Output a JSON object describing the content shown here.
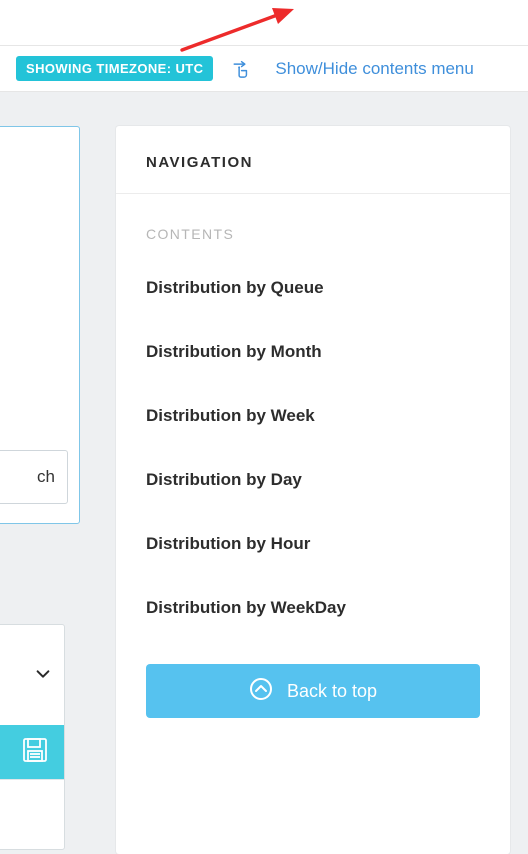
{
  "header": {
    "timezone_badge": "SHOWING TIMEZONE: UTC",
    "menu_link": "Show/Hide contents menu"
  },
  "left_fragments": {
    "search_partial": "ch"
  },
  "navigation": {
    "title": "NAVIGATION",
    "section_label": "CONTENTS",
    "items": [
      {
        "label": "Distribution by Queue"
      },
      {
        "label": "Distribution by Month"
      },
      {
        "label": "Distribution by Week"
      },
      {
        "label": "Distribution by Day"
      },
      {
        "label": "Distribution by Hour"
      },
      {
        "label": "Distribution by WeekDay"
      }
    ],
    "back_to_top": "Back to top"
  },
  "colors": {
    "accent_teal": "#23c3d8",
    "accent_blue": "#56c2ef",
    "link_blue": "#3f8fdb",
    "arrow_red": "#ed2b2b"
  }
}
